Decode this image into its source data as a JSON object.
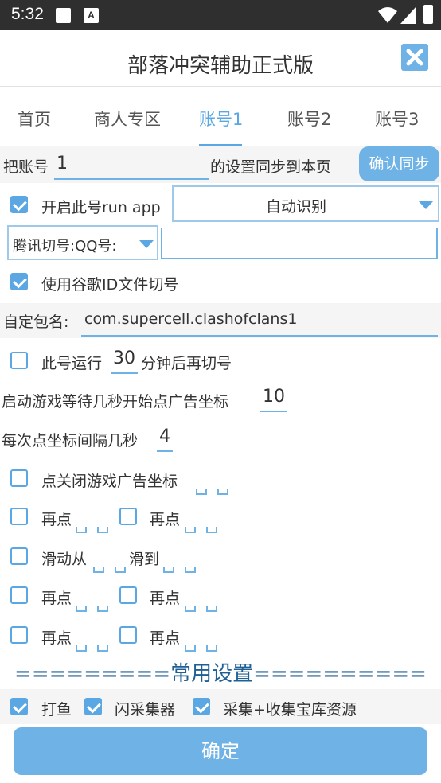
{
  "status": {
    "time": "5:32",
    "badge": "A"
  },
  "app": {
    "title": "部落冲突辅助正式版"
  },
  "tabs": [
    {
      "label": "首页"
    },
    {
      "label": "商人专区"
    },
    {
      "label": "账号1"
    },
    {
      "label": "账号2"
    },
    {
      "label": "账号3"
    }
  ],
  "sync": {
    "prefix": "把账号",
    "value": "1",
    "suffix": "的设置同步到本页",
    "button": "确认同步"
  },
  "runapp": {
    "label": "开启此号run app",
    "checked": true,
    "select_value": "自动识别"
  },
  "tencent": {
    "select_value": "腾讯切号:QQ号:",
    "input_value": ""
  },
  "google": {
    "label": "使用谷歌ID文件切号",
    "checked": true
  },
  "package": {
    "label": "自定包名:",
    "value": "com.supercell.clashofclans1"
  },
  "run_minutes": {
    "label_pre": "此号运行",
    "value": "30",
    "label_post": "分钟后再切号",
    "checked": false
  },
  "wait_seconds": {
    "label": "启动游戏等待几秒开始点广告坐标",
    "value": "10"
  },
  "interval_seconds": {
    "label": "每次点坐标间隔几秒",
    "value": "4"
  },
  "close_ad": {
    "label": "点关闭游戏广告坐标",
    "checked": false
  },
  "clicks": {
    "again": "再点",
    "swipe_from": "滑动从",
    "swipe_to": "滑到"
  },
  "common": {
    "header": "=========常用设置==========",
    "fish": {
      "label": "打鱼",
      "checked": true
    },
    "flash": {
      "label": "闪采集器",
      "checked": true
    },
    "collect": {
      "label": "采集+收集宝库资源",
      "checked": true
    }
  },
  "confirm_button": "确定",
  "colors": {
    "accent": "#5aa7e3",
    "button": "#6fb2e6",
    "header_text": "#1f5f94"
  }
}
